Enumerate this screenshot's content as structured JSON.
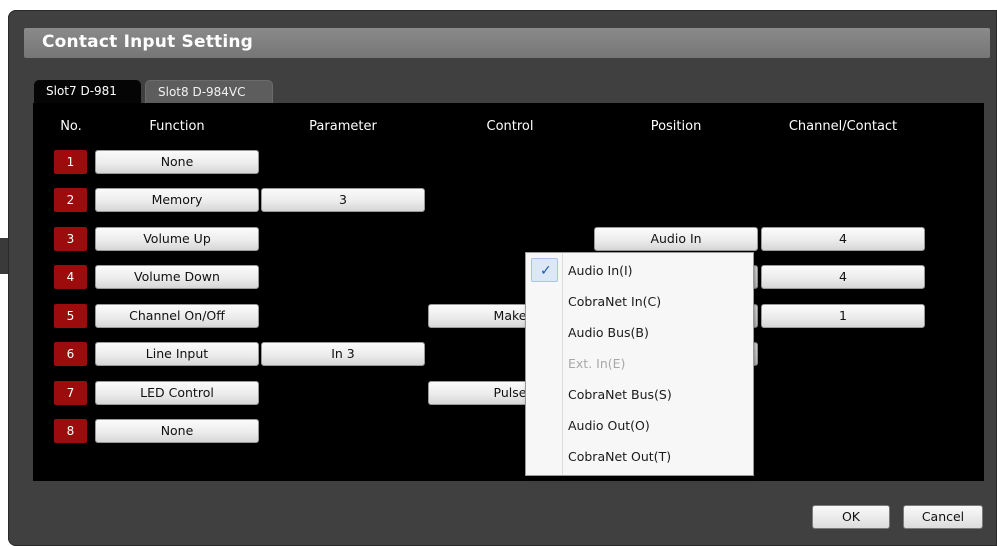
{
  "window": {
    "title": "Contact Input Setting"
  },
  "tabs": [
    {
      "label": "Slot7  D-981",
      "active": true
    },
    {
      "label": "Slot8  D-984VC",
      "active": false
    }
  ],
  "columns": [
    "No.",
    "Function",
    "Parameter",
    "Control",
    "Position",
    "Channel/Contact"
  ],
  "rows": [
    {
      "no": "1",
      "function": "None",
      "parameter": "",
      "control": "",
      "position": "",
      "channel": ""
    },
    {
      "no": "2",
      "function": "Memory",
      "parameter": "3",
      "control": "",
      "position": "",
      "channel": ""
    },
    {
      "no": "3",
      "function": "Volume Up",
      "parameter": "",
      "control": "",
      "position": "Audio In",
      "channel": "4"
    },
    {
      "no": "4",
      "function": "Volume Down",
      "parameter": "",
      "control": "",
      "position": "",
      "channel": "4"
    },
    {
      "no": "5",
      "function": "Channel On/Off",
      "parameter": "",
      "control": "Make",
      "position": "",
      "channel": "1"
    },
    {
      "no": "6",
      "function": "Line Input",
      "parameter": "In 3",
      "control": "",
      "position": "",
      "channel": ""
    },
    {
      "no": "7",
      "function": "LED Control",
      "parameter": "",
      "control": "Pulse",
      "position": "",
      "channel": ""
    },
    {
      "no": "8",
      "function": "None",
      "parameter": "",
      "control": "",
      "position": "",
      "channel": ""
    }
  ],
  "dropdown": {
    "items": [
      {
        "label": "Audio In(I)",
        "checked": true,
        "disabled": false
      },
      {
        "label": "CobraNet In(C)",
        "checked": false,
        "disabled": false
      },
      {
        "label": "Audio Bus(B)",
        "checked": false,
        "disabled": false
      },
      {
        "label": "Ext. In(E)",
        "checked": false,
        "disabled": true
      },
      {
        "label": "CobraNet Bus(S)",
        "checked": false,
        "disabled": false
      },
      {
        "label": "Audio Out(O)",
        "checked": false,
        "disabled": false
      },
      {
        "label": "CobraNet Out(T)",
        "checked": false,
        "disabled": false
      }
    ],
    "check_glyph": "✓"
  },
  "footer": {
    "ok_label": "OK",
    "cancel_label": "Cancel"
  },
  "colors": {
    "row_number_bg": "#9c0c0c",
    "panel_bg": "#000000",
    "dialog_bg": "#404040",
    "title_bg": "#7f7f7f"
  }
}
